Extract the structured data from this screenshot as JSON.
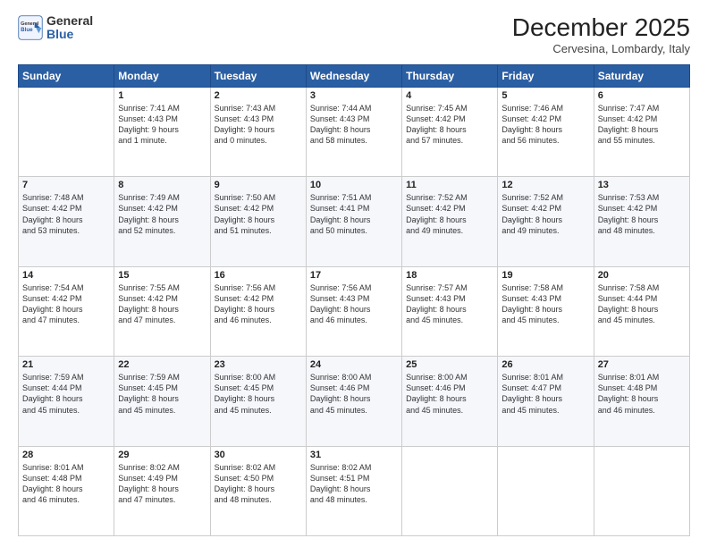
{
  "header": {
    "logo_general": "General",
    "logo_blue": "Blue",
    "month_title": "December 2025",
    "location": "Cervesina, Lombardy, Italy"
  },
  "days_of_week": [
    "Sunday",
    "Monday",
    "Tuesday",
    "Wednesday",
    "Thursday",
    "Friday",
    "Saturday"
  ],
  "weeks": [
    [
      {
        "day": "",
        "info": ""
      },
      {
        "day": "1",
        "info": "Sunrise: 7:41 AM\nSunset: 4:43 PM\nDaylight: 9 hours\nand 1 minute."
      },
      {
        "day": "2",
        "info": "Sunrise: 7:43 AM\nSunset: 4:43 PM\nDaylight: 9 hours\nand 0 minutes."
      },
      {
        "day": "3",
        "info": "Sunrise: 7:44 AM\nSunset: 4:43 PM\nDaylight: 8 hours\nand 58 minutes."
      },
      {
        "day": "4",
        "info": "Sunrise: 7:45 AM\nSunset: 4:42 PM\nDaylight: 8 hours\nand 57 minutes."
      },
      {
        "day": "5",
        "info": "Sunrise: 7:46 AM\nSunset: 4:42 PM\nDaylight: 8 hours\nand 56 minutes."
      },
      {
        "day": "6",
        "info": "Sunrise: 7:47 AM\nSunset: 4:42 PM\nDaylight: 8 hours\nand 55 minutes."
      }
    ],
    [
      {
        "day": "7",
        "info": "Sunrise: 7:48 AM\nSunset: 4:42 PM\nDaylight: 8 hours\nand 53 minutes."
      },
      {
        "day": "8",
        "info": "Sunrise: 7:49 AM\nSunset: 4:42 PM\nDaylight: 8 hours\nand 52 minutes."
      },
      {
        "day": "9",
        "info": "Sunrise: 7:50 AM\nSunset: 4:42 PM\nDaylight: 8 hours\nand 51 minutes."
      },
      {
        "day": "10",
        "info": "Sunrise: 7:51 AM\nSunset: 4:41 PM\nDaylight: 8 hours\nand 50 minutes."
      },
      {
        "day": "11",
        "info": "Sunrise: 7:52 AM\nSunset: 4:42 PM\nDaylight: 8 hours\nand 49 minutes."
      },
      {
        "day": "12",
        "info": "Sunrise: 7:52 AM\nSunset: 4:42 PM\nDaylight: 8 hours\nand 49 minutes."
      },
      {
        "day": "13",
        "info": "Sunrise: 7:53 AM\nSunset: 4:42 PM\nDaylight: 8 hours\nand 48 minutes."
      }
    ],
    [
      {
        "day": "14",
        "info": "Sunrise: 7:54 AM\nSunset: 4:42 PM\nDaylight: 8 hours\nand 47 minutes."
      },
      {
        "day": "15",
        "info": "Sunrise: 7:55 AM\nSunset: 4:42 PM\nDaylight: 8 hours\nand 47 minutes."
      },
      {
        "day": "16",
        "info": "Sunrise: 7:56 AM\nSunset: 4:42 PM\nDaylight: 8 hours\nand 46 minutes."
      },
      {
        "day": "17",
        "info": "Sunrise: 7:56 AM\nSunset: 4:43 PM\nDaylight: 8 hours\nand 46 minutes."
      },
      {
        "day": "18",
        "info": "Sunrise: 7:57 AM\nSunset: 4:43 PM\nDaylight: 8 hours\nand 45 minutes."
      },
      {
        "day": "19",
        "info": "Sunrise: 7:58 AM\nSunset: 4:43 PM\nDaylight: 8 hours\nand 45 minutes."
      },
      {
        "day": "20",
        "info": "Sunrise: 7:58 AM\nSunset: 4:44 PM\nDaylight: 8 hours\nand 45 minutes."
      }
    ],
    [
      {
        "day": "21",
        "info": "Sunrise: 7:59 AM\nSunset: 4:44 PM\nDaylight: 8 hours\nand 45 minutes."
      },
      {
        "day": "22",
        "info": "Sunrise: 7:59 AM\nSunset: 4:45 PM\nDaylight: 8 hours\nand 45 minutes."
      },
      {
        "day": "23",
        "info": "Sunrise: 8:00 AM\nSunset: 4:45 PM\nDaylight: 8 hours\nand 45 minutes."
      },
      {
        "day": "24",
        "info": "Sunrise: 8:00 AM\nSunset: 4:46 PM\nDaylight: 8 hours\nand 45 minutes."
      },
      {
        "day": "25",
        "info": "Sunrise: 8:00 AM\nSunset: 4:46 PM\nDaylight: 8 hours\nand 45 minutes."
      },
      {
        "day": "26",
        "info": "Sunrise: 8:01 AM\nSunset: 4:47 PM\nDaylight: 8 hours\nand 45 minutes."
      },
      {
        "day": "27",
        "info": "Sunrise: 8:01 AM\nSunset: 4:48 PM\nDaylight: 8 hours\nand 46 minutes."
      }
    ],
    [
      {
        "day": "28",
        "info": "Sunrise: 8:01 AM\nSunset: 4:48 PM\nDaylight: 8 hours\nand 46 minutes."
      },
      {
        "day": "29",
        "info": "Sunrise: 8:02 AM\nSunset: 4:49 PM\nDaylight: 8 hours\nand 47 minutes."
      },
      {
        "day": "30",
        "info": "Sunrise: 8:02 AM\nSunset: 4:50 PM\nDaylight: 8 hours\nand 48 minutes."
      },
      {
        "day": "31",
        "info": "Sunrise: 8:02 AM\nSunset: 4:51 PM\nDaylight: 8 hours\nand 48 minutes."
      },
      {
        "day": "",
        "info": ""
      },
      {
        "day": "",
        "info": ""
      },
      {
        "day": "",
        "info": ""
      }
    ]
  ]
}
